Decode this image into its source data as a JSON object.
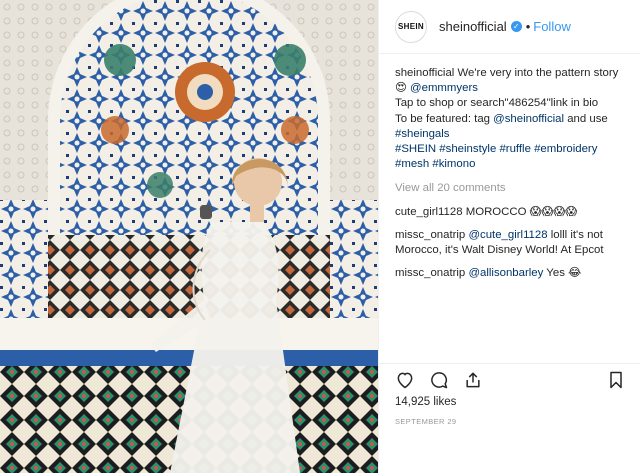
{
  "account": {
    "logo_text": "SHEIN",
    "username": "sheinofficial",
    "verified_mark": "✓",
    "separator": "•",
    "follow_label": "Follow"
  },
  "caption": {
    "username": "sheinofficial",
    "line1": " We're very into the pattern story",
    "emoji": "😍",
    "mention": "@emmmyers",
    "line3": "Tap to shop or search\"486254\"link in bio",
    "line4a": "To be featured: tag ",
    "line4_mention": "@sheinofficial",
    "line4b": " and use",
    "line5": "#sheingals",
    "line6": "#SHEIN #sheinstyle #ruffle #embroidery",
    "line7": "#mesh #kimono"
  },
  "view_all_label": "View all 20 comments",
  "comments": [
    {
      "user": "cute_girl1128",
      "text": " MOROCCO 😱😱😱😱"
    },
    {
      "user": "missc_onatrip",
      "mention": "@cute_girl1128",
      "text": " lolll it's not",
      "text2": "Morocco, it's Walt Disney World! At Epcot"
    },
    {
      "user": "missc_onatrip",
      "mention": "@allisonbarley",
      "text": " Yes 😂"
    }
  ],
  "likes_label": "14,925 likes",
  "date_label": "SEPTEMBER 29",
  "icons": [
    "heart-icon",
    "comment-icon",
    "share-icon",
    "bookmark-icon"
  ],
  "colors": {
    "link": "#003569",
    "follow": "#3897f0",
    "muted": "#999999"
  }
}
